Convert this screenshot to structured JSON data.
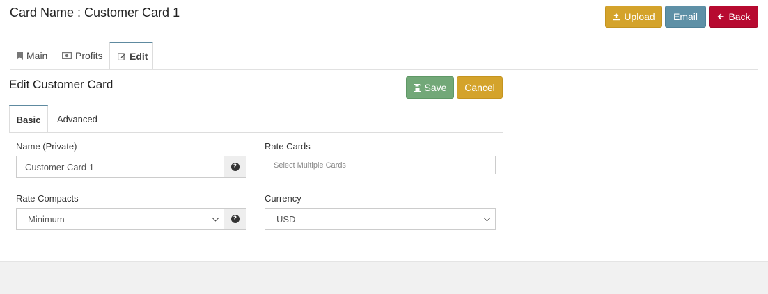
{
  "header": {
    "title": "Card Name : Customer Card 1",
    "upload_label": "Upload",
    "email_label": "Email",
    "back_label": "Back"
  },
  "tabs": [
    {
      "label": "Main",
      "icon": "bookmark-icon"
    },
    {
      "label": "Profits",
      "icon": "money-icon"
    },
    {
      "label": "Edit",
      "icon": "edit-icon",
      "active": true
    }
  ],
  "form": {
    "title": "Edit Customer Card",
    "save_label": "Save",
    "cancel_label": "Cancel",
    "subtabs": [
      {
        "label": "Basic",
        "active": true
      },
      {
        "label": "Advanced"
      }
    ],
    "name": {
      "label": "Name (Private)",
      "value": "Customer Card 1"
    },
    "rate_cards": {
      "label": "Rate Cards",
      "placeholder": "Select Multiple Cards"
    },
    "rate_compacts": {
      "label": "Rate Compacts",
      "value": "Minimum"
    },
    "currency": {
      "label": "Currency",
      "value": "USD"
    }
  },
  "colors": {
    "upload": "#d4a32b",
    "email": "#5e90a6",
    "back": "#b70a30",
    "save": "#72a878",
    "cancel": "#d4a32b",
    "active_tab_border": "#5e8aa0"
  }
}
